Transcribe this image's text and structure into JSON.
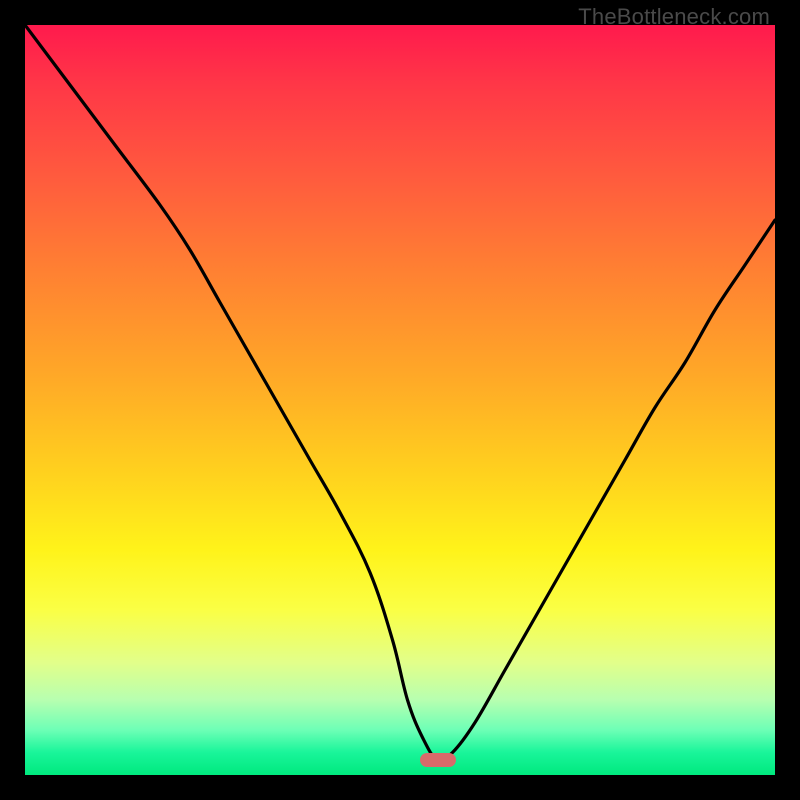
{
  "watermark": "TheBottleneck.com",
  "colors": {
    "frame_bg": "#000000",
    "curve_stroke": "#000000",
    "marker_fill": "#d86a6a",
    "gradient_top": "#ff1a4d",
    "gradient_bottom": "#00e97e"
  },
  "chart_data": {
    "type": "line",
    "title": "",
    "xlabel": "",
    "ylabel": "",
    "xlim": [
      0,
      100
    ],
    "ylim": [
      0,
      100
    ],
    "grid": false,
    "legend": false,
    "annotations": [
      {
        "kind": "marker",
        "shape": "pill",
        "x": 55,
        "y": 2,
        "color": "#d86a6a"
      }
    ],
    "series": [
      {
        "name": "bottleneck-curve",
        "x": [
          0,
          6,
          12,
          18,
          22,
          26,
          30,
          34,
          38,
          42,
          46,
          49,
          51,
          53,
          55,
          57,
          60,
          64,
          68,
          72,
          76,
          80,
          84,
          88,
          92,
          96,
          100
        ],
        "values": [
          100,
          92,
          84,
          76,
          70,
          63,
          56,
          49,
          42,
          35,
          27,
          18,
          10,
          5,
          2,
          3,
          7,
          14,
          21,
          28,
          35,
          42,
          49,
          55,
          62,
          68,
          74
        ]
      }
    ],
    "background_gradient": {
      "direction": "vertical",
      "stops": [
        {
          "pos": 0,
          "color": "#ff1a4d"
        },
        {
          "pos": 20,
          "color": "#ff5a3e"
        },
        {
          "pos": 47,
          "color": "#ffa927"
        },
        {
          "pos": 70,
          "color": "#fff31a"
        },
        {
          "pos": 90,
          "color": "#b7ffb0"
        },
        {
          "pos": 100,
          "color": "#00e97e"
        }
      ]
    }
  }
}
